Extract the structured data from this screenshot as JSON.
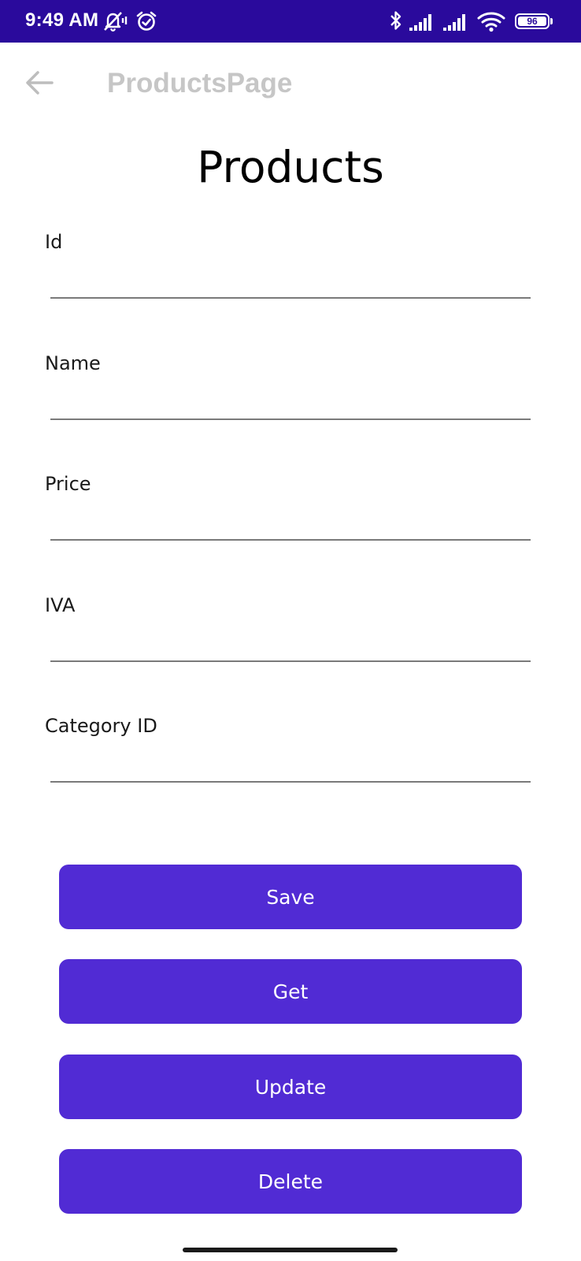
{
  "status_bar": {
    "time": "9:49 AM",
    "battery_level": "96",
    "background_color": "#2a0a9c",
    "icons": [
      "mute-notifications-icon",
      "alarm-icon",
      "bluetooth-icon",
      "signal-icon",
      "signal-icon",
      "wifi-icon",
      "battery-icon"
    ]
  },
  "toolbar": {
    "title": "ProductsPage",
    "back_icon": "arrow-left-icon"
  },
  "page": {
    "heading": "Products"
  },
  "form": {
    "fields": [
      {
        "label": "Id",
        "value": "",
        "placeholder": ""
      },
      {
        "label": "Name",
        "value": "",
        "placeholder": ""
      },
      {
        "label": "Price",
        "value": "",
        "placeholder": ""
      },
      {
        "label": "IVA",
        "value": "",
        "placeholder": ""
      },
      {
        "label": "Category ID",
        "value": "",
        "placeholder": ""
      }
    ]
  },
  "buttons": {
    "save": "Save",
    "get": "Get",
    "update": "Update",
    "delete": "Delete",
    "color": "#512bd4"
  }
}
